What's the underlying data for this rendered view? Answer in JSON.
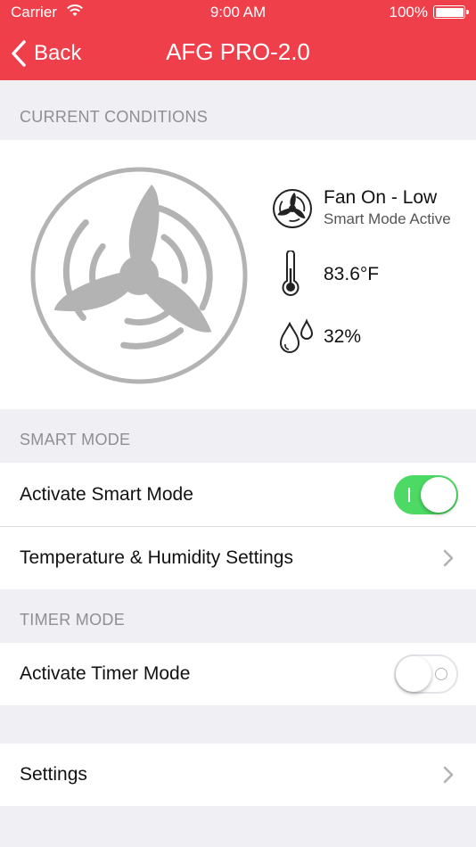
{
  "status_bar": {
    "carrier": "Carrier",
    "time": "9:00 AM",
    "battery": "100%"
  },
  "nav": {
    "back_label": "Back",
    "title": "AFG PRO-2.0"
  },
  "current_conditions": {
    "header": "CURRENT CONDITIONS",
    "fan_status": "Fan On - Low",
    "mode_status": "Smart Mode Active",
    "temperature": "83.6°F",
    "humidity": "32%"
  },
  "smart_mode": {
    "header": "SMART MODE",
    "activate_label": "Activate Smart Mode",
    "activate_on": true,
    "settings_label": "Temperature & Humidity Settings"
  },
  "timer_mode": {
    "header": "TIMER MODE",
    "activate_label": "Activate Timer Mode",
    "activate_on": false
  },
  "settings": {
    "label": "Settings"
  },
  "colors": {
    "brand": "#ef3f4a",
    "toggle_on": "#4cd964",
    "icon_gray": "#b3b3b3"
  }
}
